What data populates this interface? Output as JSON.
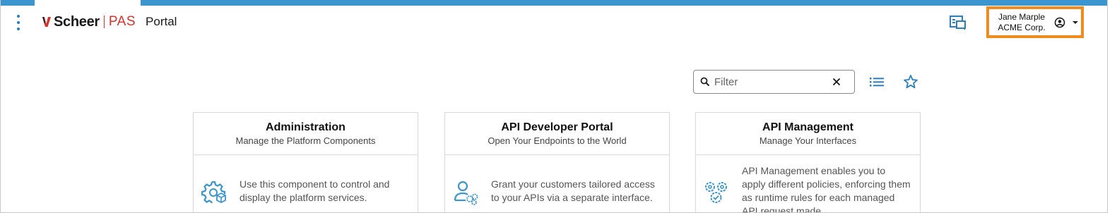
{
  "header": {
    "brand_name": "Scheer",
    "brand_product": "PAS",
    "app_title": "Portal",
    "user_name": "Jane Marple",
    "user_org": "ACME Corp."
  },
  "toolbar": {
    "filter_placeholder": "Filter",
    "filter_value": ""
  },
  "cards": [
    {
      "title": "Administration",
      "subtitle": "Manage the Platform Components",
      "description": "Use this component to control and display the platform services.",
      "icon": "settings-cube-icon"
    },
    {
      "title": "API Developer Portal",
      "subtitle": "Open Your Endpoints to the World",
      "description": "Grant your customers tailored access to your APIs via a separate interface.",
      "icon": "user-gears-icon"
    },
    {
      "title": "API Management",
      "subtitle": "Manage Your Interfaces",
      "description": "API Management enables you to apply different policies, enforcing them as runtime rules for each managed API request made.",
      "icon": "gears-check-icon"
    }
  ],
  "colors": {
    "accent": "#3b95cf",
    "brand_red": "#d3332c",
    "highlight": "#f08c1e",
    "icon_blue": "#2a7fc0"
  },
  "icons": {
    "menu": "kebab-menu-icon",
    "chat": "chat-icon",
    "user": "user-circle-icon",
    "caret": "caret-down-icon",
    "search": "search-icon",
    "clear": "close-icon",
    "list": "list-view-icon",
    "favorites": "star-icon"
  }
}
